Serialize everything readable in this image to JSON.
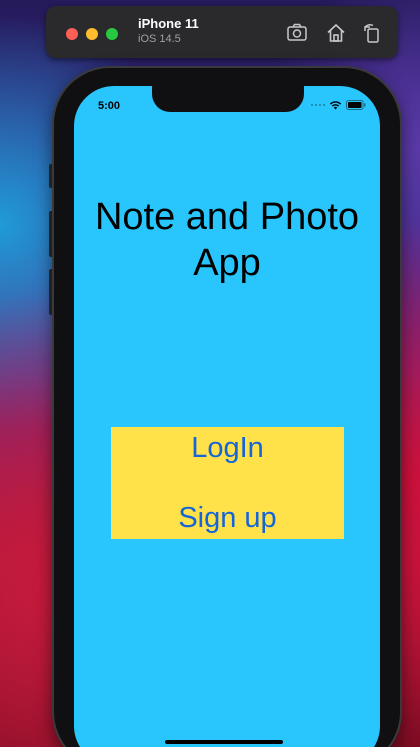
{
  "simulator": {
    "device_name": "iPhone 11",
    "os_version": "iOS 14.5",
    "toolbar_icons": [
      "screenshot-icon",
      "home-icon",
      "rotate-icon"
    ]
  },
  "status_bar": {
    "time": "5:00",
    "icons": [
      "wifi-icon",
      "battery-icon"
    ]
  },
  "app": {
    "title": "Note and Photo App",
    "login_label": "LogIn",
    "signup_label": "Sign up"
  },
  "colors": {
    "screen_background": "#29c6fd",
    "button_panel": "#ffe14a",
    "button_text": "#1565d8",
    "title_text": "#000000"
  }
}
